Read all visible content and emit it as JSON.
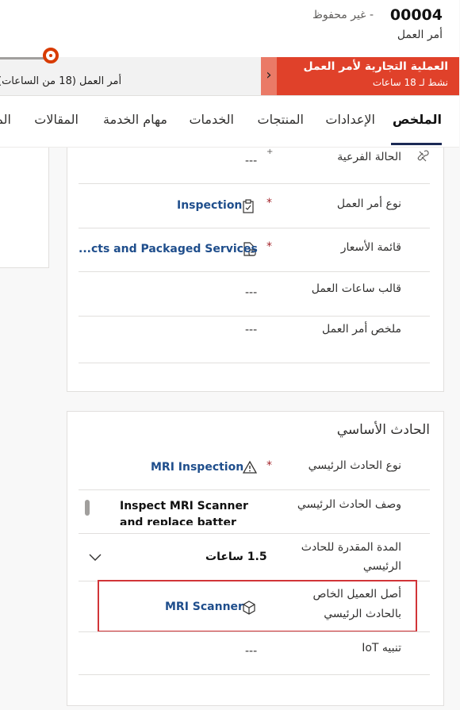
{
  "header": {
    "record_number": "00004",
    "save_status": "- غير محفوظ",
    "entity_name": "أمر العمل"
  },
  "bpf": {
    "active_stage_title": "العملية التجارية لأمر العمل",
    "active_stage_subtitle": "نشط لـ 18 ساعات",
    "current_stage_label": "أمر العمل  (18 من الساعات)"
  },
  "tabs": [
    {
      "label": "الملخص",
      "active": true
    },
    {
      "label": "الإعدادات"
    },
    {
      "label": "المنتجات"
    },
    {
      "label": "الخدمات"
    },
    {
      "label": "مهام الخدمة"
    },
    {
      "label": "المقالات"
    },
    {
      "label": "الم"
    }
  ],
  "summary": {
    "substatus": {
      "label": "الحالة الفرعية",
      "value": "---"
    },
    "work_order_type": {
      "label": "نوع أمر العمل",
      "value": "Inspection"
    },
    "price_list": {
      "label": "قائمة الأسعار",
      "value": "...cts and Packaged Services"
    },
    "work_hours_template": {
      "label": "قالب ساعات العمل",
      "value": "---"
    },
    "work_order_summary": {
      "label": "ملخص أمر العمل",
      "value": "---"
    }
  },
  "primary_incident": {
    "section_title": "الحادث الأساسي",
    "incident_type": {
      "label": "نوع الحادث الرئيسي",
      "value": "MRI Inspection"
    },
    "description": {
      "label": "وصف الحادث الرئيسي",
      "value": "Inspect MRI Scanner and replace batter and coils if needed"
    },
    "estimated_duration": {
      "label_line1": "المدة المقدرة للحادث",
      "label_line2": "الرئيسي",
      "value": "1.5 ساعات"
    },
    "customer_asset": {
      "label_line1": "أصل العميل الخاص",
      "label_line2": "بالحادث الرئيسي",
      "value": "MRI Scanner"
    },
    "iot_alert": {
      "label": "تنبيه IoT",
      "value": "---"
    }
  },
  "colors": {
    "active_stage_bg": "#e0412a",
    "link": "#1f4e8c",
    "required": "#a4262c",
    "highlight": "#d13438",
    "tab_underline": "#1c2a55"
  }
}
